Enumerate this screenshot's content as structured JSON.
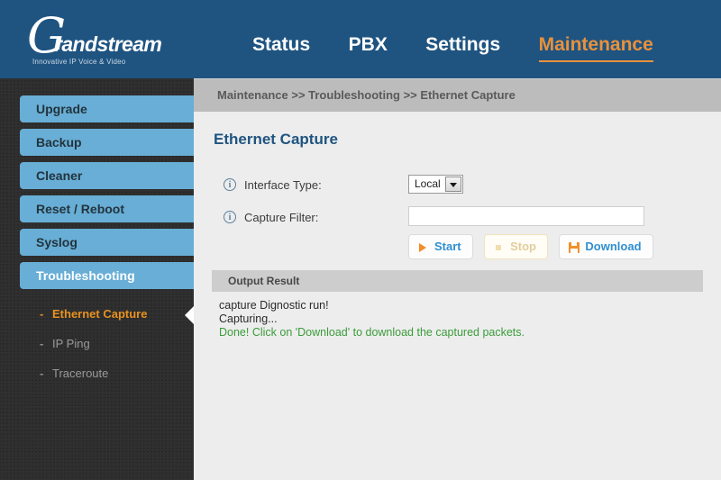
{
  "header": {
    "logo": {
      "mark": "G",
      "word": "randstream",
      "tagline": "Innovative IP Voice & Video"
    },
    "nav": [
      {
        "label": "Status",
        "active": false
      },
      {
        "label": "PBX",
        "active": false
      },
      {
        "label": "Settings",
        "active": false
      },
      {
        "label": "Maintenance",
        "active": true
      }
    ],
    "accent_color": "#e8913c",
    "bar_color": "#1f5481"
  },
  "breadcrumb": {
    "text": "Maintenance >> Troubleshooting >> Ethernet Capture",
    "refresh_icon": "refresh-icon"
  },
  "sidebar": {
    "items": [
      {
        "label": "Upgrade",
        "active": false
      },
      {
        "label": "Backup",
        "active": false
      },
      {
        "label": "Cleaner",
        "active": false
      },
      {
        "label": "Reset / Reboot",
        "active": false
      },
      {
        "label": "Syslog",
        "active": false
      },
      {
        "label": "Troubleshooting",
        "active": true
      }
    ],
    "sub_items": [
      {
        "label": "Ethernet Capture",
        "dash": "-",
        "active": true
      },
      {
        "label": "IP Ping",
        "dash": "-",
        "active": false
      },
      {
        "label": "Traceroute",
        "dash": "-",
        "active": false
      }
    ],
    "item_color": "#68aed6",
    "active_sub_color": "#e8911f"
  },
  "main": {
    "title": "Ethernet Capture",
    "fields": [
      {
        "info_icon": "info-icon",
        "label": "Interface Type:",
        "type": "select",
        "value": "Local"
      },
      {
        "info_icon": "info-icon",
        "label": "Capture Filter:",
        "type": "text",
        "value": "",
        "placeholder": ""
      }
    ],
    "buttons": [
      {
        "label": "Start",
        "icon": "play-icon",
        "disabled": false
      },
      {
        "label": "Stop",
        "icon": "stop-icon",
        "disabled": true
      },
      {
        "label": "Download",
        "icon": "save-icon",
        "disabled": false
      }
    ],
    "output": {
      "header": "Output Result",
      "lines": [
        {
          "text": "capture Dignostic run!",
          "status": "normal"
        },
        {
          "text": "Capturing...",
          "status": "normal"
        },
        {
          "text": "Done! Click on 'Download' to download the captured packets.",
          "status": "ok"
        }
      ],
      "ok_color": "#3b9c3b"
    }
  }
}
